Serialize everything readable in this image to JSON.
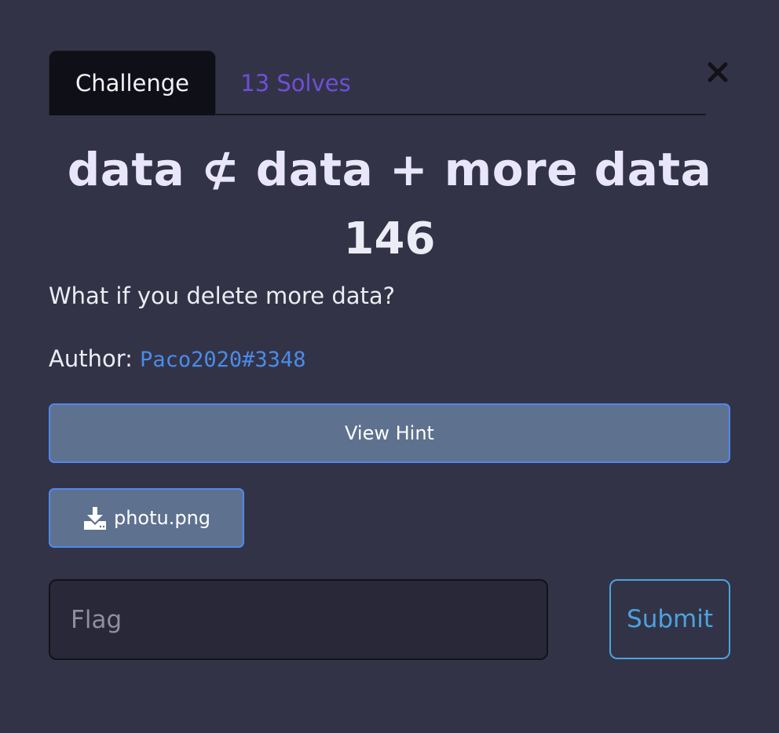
{
  "tabs": [
    {
      "label": "Challenge",
      "active": true
    },
    {
      "label": "13 Solves",
      "active": false
    }
  ],
  "challenge": {
    "name": "data ⊄ data + more data",
    "value": "146",
    "description": "What if you delete more data?",
    "author_label": "Author: ",
    "author_name": "Paco2020#3348"
  },
  "buttons": {
    "hint_label": "View Hint",
    "file_label": "photu.png",
    "submit_label": "Submit"
  },
  "flag_input": {
    "placeholder": "Flag",
    "value": ""
  },
  "icons": {
    "close": "close-icon",
    "download": "download-icon"
  },
  "colors": {
    "background": "#333347",
    "tab_active_bg": "#0f0f17",
    "solves_link": "#6e4fd8",
    "author_link": "#4a8ce8",
    "button_bg": "#5e718f",
    "button_border": "#4f88ef",
    "submit_accent": "#4aa3df"
  }
}
